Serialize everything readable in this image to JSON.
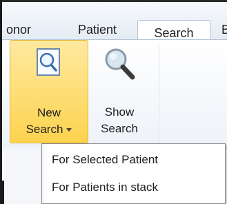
{
  "tabs": [
    {
      "label": "Donor",
      "visible_text": "onor"
    },
    {
      "label": "Patient",
      "visible_text": "Patient"
    },
    {
      "label": "Search",
      "visible_text": "Search",
      "selected": true
    },
    {
      "label": "B",
      "visible_text": "B"
    }
  ],
  "ribbon": {
    "new_search": {
      "line1": "New",
      "line2": "Search",
      "icon": "magnifier-document-icon",
      "highlighted": true
    },
    "show_search": {
      "line1": "Show",
      "line2": "Search",
      "icon": "magnifier-icon"
    }
  },
  "dropdown_menu": {
    "items": [
      "For Selected Patient",
      "For Patients in stack"
    ]
  },
  "colors": {
    "highlight": "#fcd34e",
    "highlight_border": "#e4b23c",
    "tab_border": "#b6c4d4"
  }
}
